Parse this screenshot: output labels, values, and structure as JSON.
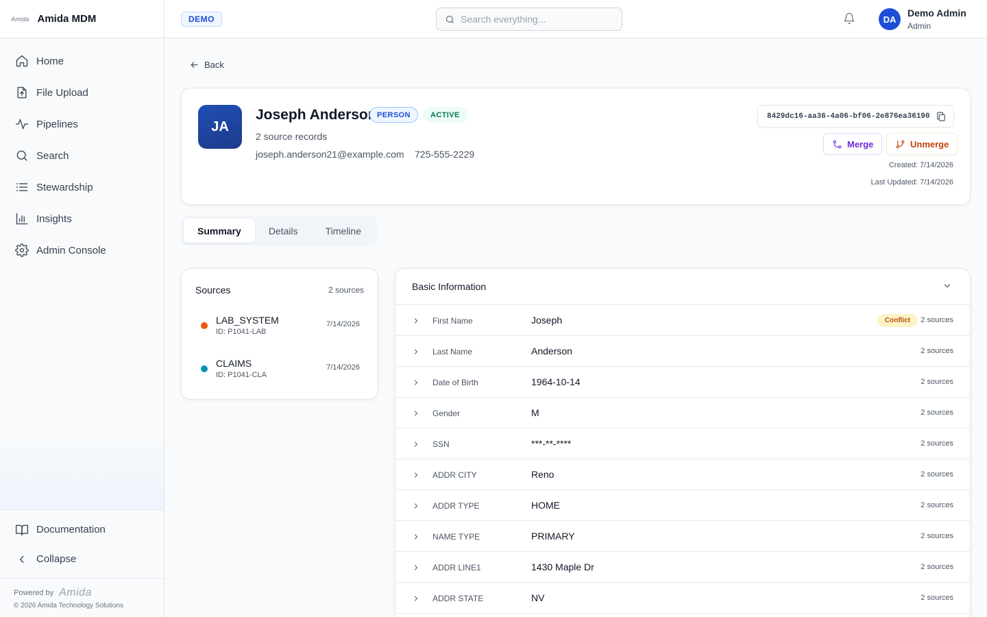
{
  "brand": {
    "logo_text": "Amida",
    "app_name": "Amida MDM"
  },
  "sidebar": {
    "items": [
      {
        "label": "Home",
        "icon": "home-icon"
      },
      {
        "label": "File Upload",
        "icon": "file-upload-icon"
      },
      {
        "label": "Pipelines",
        "icon": "activity-icon"
      },
      {
        "label": "Search",
        "icon": "search-icon"
      },
      {
        "label": "Stewardship",
        "icon": "list-icon"
      },
      {
        "label": "Insights",
        "icon": "bar-chart-icon"
      },
      {
        "label": "Admin Console",
        "icon": "gear-icon"
      }
    ],
    "documentation_label": "Documentation",
    "collapse_label": "Collapse",
    "powered_by": "Powered by",
    "powered_logo": "Amida",
    "copyright": "© 2026 Amida Technology Solutions"
  },
  "header": {
    "env_badge": "DEMO",
    "search_placeholder": "Search everything...",
    "user_initials": "DA",
    "user_name": "Demo Admin",
    "user_role": "Admin"
  },
  "page": {
    "back_label": "Back",
    "entity": {
      "initials": "JA",
      "name": "Joseph Anderson",
      "type_badge": "PERSON",
      "status_badge": "ACTIVE",
      "source_records": "2 source records",
      "email": "joseph.anderson21@example.com",
      "phone": "725-555-2229",
      "id": "8429dc16-aa36-4a06-bf06-2e876ea36190",
      "merge_label": "Merge",
      "unmerge_label": "Unmerge",
      "created": "Created: 7/14/2026",
      "updated": "Last Updated: 7/14/2026"
    },
    "tabs": [
      {
        "label": "Summary",
        "active": true
      },
      {
        "label": "Details",
        "active": false
      },
      {
        "label": "Timeline",
        "active": false
      }
    ],
    "sources": {
      "title": "Sources",
      "count": "2 sources",
      "items": [
        {
          "name": "LAB_SYSTEM",
          "id": "ID: P1041-LAB",
          "date": "7/14/2026",
          "color": "#ea580c"
        },
        {
          "name": "CLAIMS",
          "id": "ID: P1041-CLA",
          "date": "7/14/2026",
          "color": "#0891b2"
        }
      ]
    },
    "basic_info": {
      "title": "Basic Information",
      "conflict_label": "Conflict",
      "fields": [
        {
          "label": "First Name",
          "value": "Joseph",
          "sources": "2 sources",
          "conflict": true
        },
        {
          "label": "Last Name",
          "value": "Anderson",
          "sources": "2 sources",
          "conflict": false
        },
        {
          "label": "Date of Birth",
          "value": "1964-10-14",
          "sources": "2 sources",
          "conflict": false
        },
        {
          "label": "Gender",
          "value": "M",
          "sources": "2 sources",
          "conflict": false
        },
        {
          "label": "SSN",
          "value": "***-**-****",
          "sources": "2 sources",
          "conflict": false
        },
        {
          "label": "ADDR CITY",
          "value": "Reno",
          "sources": "2 sources",
          "conflict": false
        },
        {
          "label": "ADDR TYPE",
          "value": "HOME",
          "sources": "2 sources",
          "conflict": false
        },
        {
          "label": "NAME TYPE",
          "value": "PRIMARY",
          "sources": "2 sources",
          "conflict": false
        },
        {
          "label": "ADDR LINE1",
          "value": "1430 Maple Dr",
          "sources": "2 sources",
          "conflict": false
        },
        {
          "label": "ADDR STATE",
          "value": "NV",
          "sources": "2 sources",
          "conflict": false
        }
      ]
    }
  }
}
